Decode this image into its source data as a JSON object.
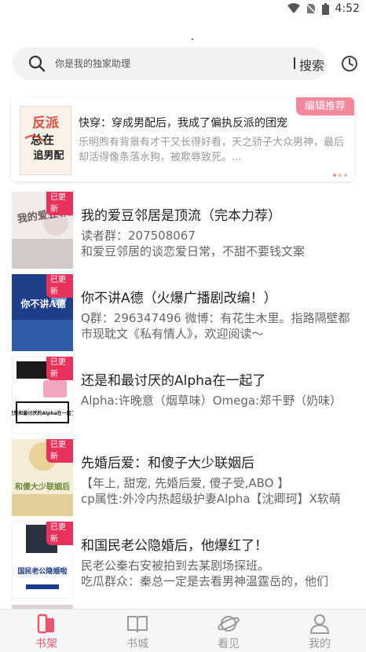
{
  "status_bar": {
    "time": "4:52"
  },
  "search": {
    "placeholder": "你是我的独家助理",
    "button_label": "搜索"
  },
  "featured": {
    "badge": "编辑推荐",
    "title": "快穿：穿成男配后，我成了偏执反派的团宠",
    "description": "乐明煦有背景有才干又长得好看，天之骄子大众男神，最后却活得像条落水狗，被欺辱致死。...",
    "cover_text": [
      "反派",
      "总在",
      "追男配"
    ],
    "dot_colors": [
      "#f3879b",
      "#f7c08a",
      "#c9c9c9"
    ]
  },
  "books": [
    {
      "badge": "已更新",
      "title": "我的爱豆邻居是顶流（完本力荐）",
      "description": "读者群：207508067\n和爱豆邻居的谈恋爱日常，不甜不要钱文案",
      "cover_text": "我的爱豆邻居",
      "cover_colors": [
        "#f2ecec",
        "#c8c0c2"
      ]
    },
    {
      "badge": "已更新",
      "title": "你不讲A德（火爆广播剧改编！）",
      "description": "Q群：296347496     微博：有花生木里。指路隔壁都市现耽文《私有情人》，欢迎阅读～",
      "cover_text": "你不讲A德",
      "cover_colors": [
        "#1e3d86",
        "#4563b0"
      ]
    },
    {
      "badge": "已更新",
      "title": "还是和最讨厌的Alpha在一起了",
      "description": "      Alpha:许晚意（烟草味）Omega:郑千野（奶味）",
      "cover_text": "还是和最讨厌的Alpha在一起了",
      "cover_colors": [
        "#ffffff",
        "#f4f4f4"
      ]
    },
    {
      "badge": "已更新",
      "title": "先婚后爱：和傻子大少联姻后",
      "description": "【年上, 甜宠, 先婚后爱, 傻子受,ABO 】\ncp属性:外冷内热超级护妻Alpha【沈卿珂】X软萌",
      "cover_text": "和傻大少联姻后",
      "cover_colors": [
        "#f3ead3",
        "#d8b96a"
      ]
    },
    {
      "badge": "已更新",
      "title": "和国民老公隐婚后，他爆红了！",
      "description": "民老公秦右安被拍到去某剧场探班。\n吃瓜群众：秦总一定是去看男神温霆岳的，他们",
      "cover_text": "国民老公隐婚啦",
      "cover_colors": [
        "#ffffff",
        "#dfe6f2"
      ]
    }
  ],
  "nav": {
    "items": [
      {
        "label": "书架",
        "icon": "bookshelf-icon",
        "active": true
      },
      {
        "label": "书城",
        "icon": "book-icon",
        "active": false
      },
      {
        "label": "看见",
        "icon": "planet-icon",
        "active": false
      },
      {
        "label": "我的",
        "icon": "user-icon",
        "active": false
      }
    ],
    "active_color": "#e8566f",
    "inactive_color": "#9a9a9a"
  },
  "colors": {
    "accent": "#e8315b",
    "badge_pink": "#f3879b"
  }
}
